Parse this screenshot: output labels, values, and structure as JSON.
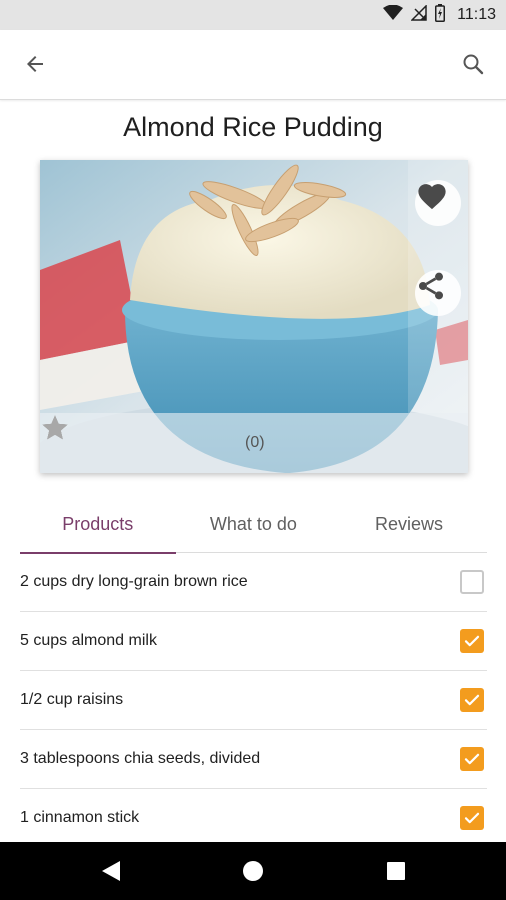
{
  "status_bar": {
    "time": "11:13",
    "icons": [
      "wifi-icon",
      "signal-icon",
      "battery-icon"
    ]
  },
  "app_bar": {
    "back_icon": "arrow-back-icon",
    "search_icon": "search-icon"
  },
  "recipe": {
    "title": "Almond Rice Pudding",
    "rating": {
      "value": 0,
      "max": 5,
      "count_label": "(0)"
    },
    "favorite_icon": "heart-icon",
    "share_icon": "share-icon"
  },
  "tabs": [
    {
      "label": "Products",
      "active": true
    },
    {
      "label": "What to do",
      "active": false
    },
    {
      "label": "Reviews",
      "active": false
    }
  ],
  "ingredients": [
    {
      "label": "2 cups dry long-grain brown rice",
      "checked": false
    },
    {
      "label": "5 cups almond milk",
      "checked": true
    },
    {
      "label": "1/2 cup raisins",
      "checked": true
    },
    {
      "label": "3 tablespoons chia seeds, divided",
      "checked": true
    },
    {
      "label": "1 cinnamon stick",
      "checked": true
    }
  ],
  "nav_bar": {
    "icons": [
      "back-triangle-icon",
      "home-circle-icon",
      "recents-square-icon"
    ]
  },
  "colors": {
    "accent": "#7a3e6a",
    "checkbox": "#f39c1e",
    "status_bar": "#e4e4e4",
    "nav_bar": "#000000"
  }
}
